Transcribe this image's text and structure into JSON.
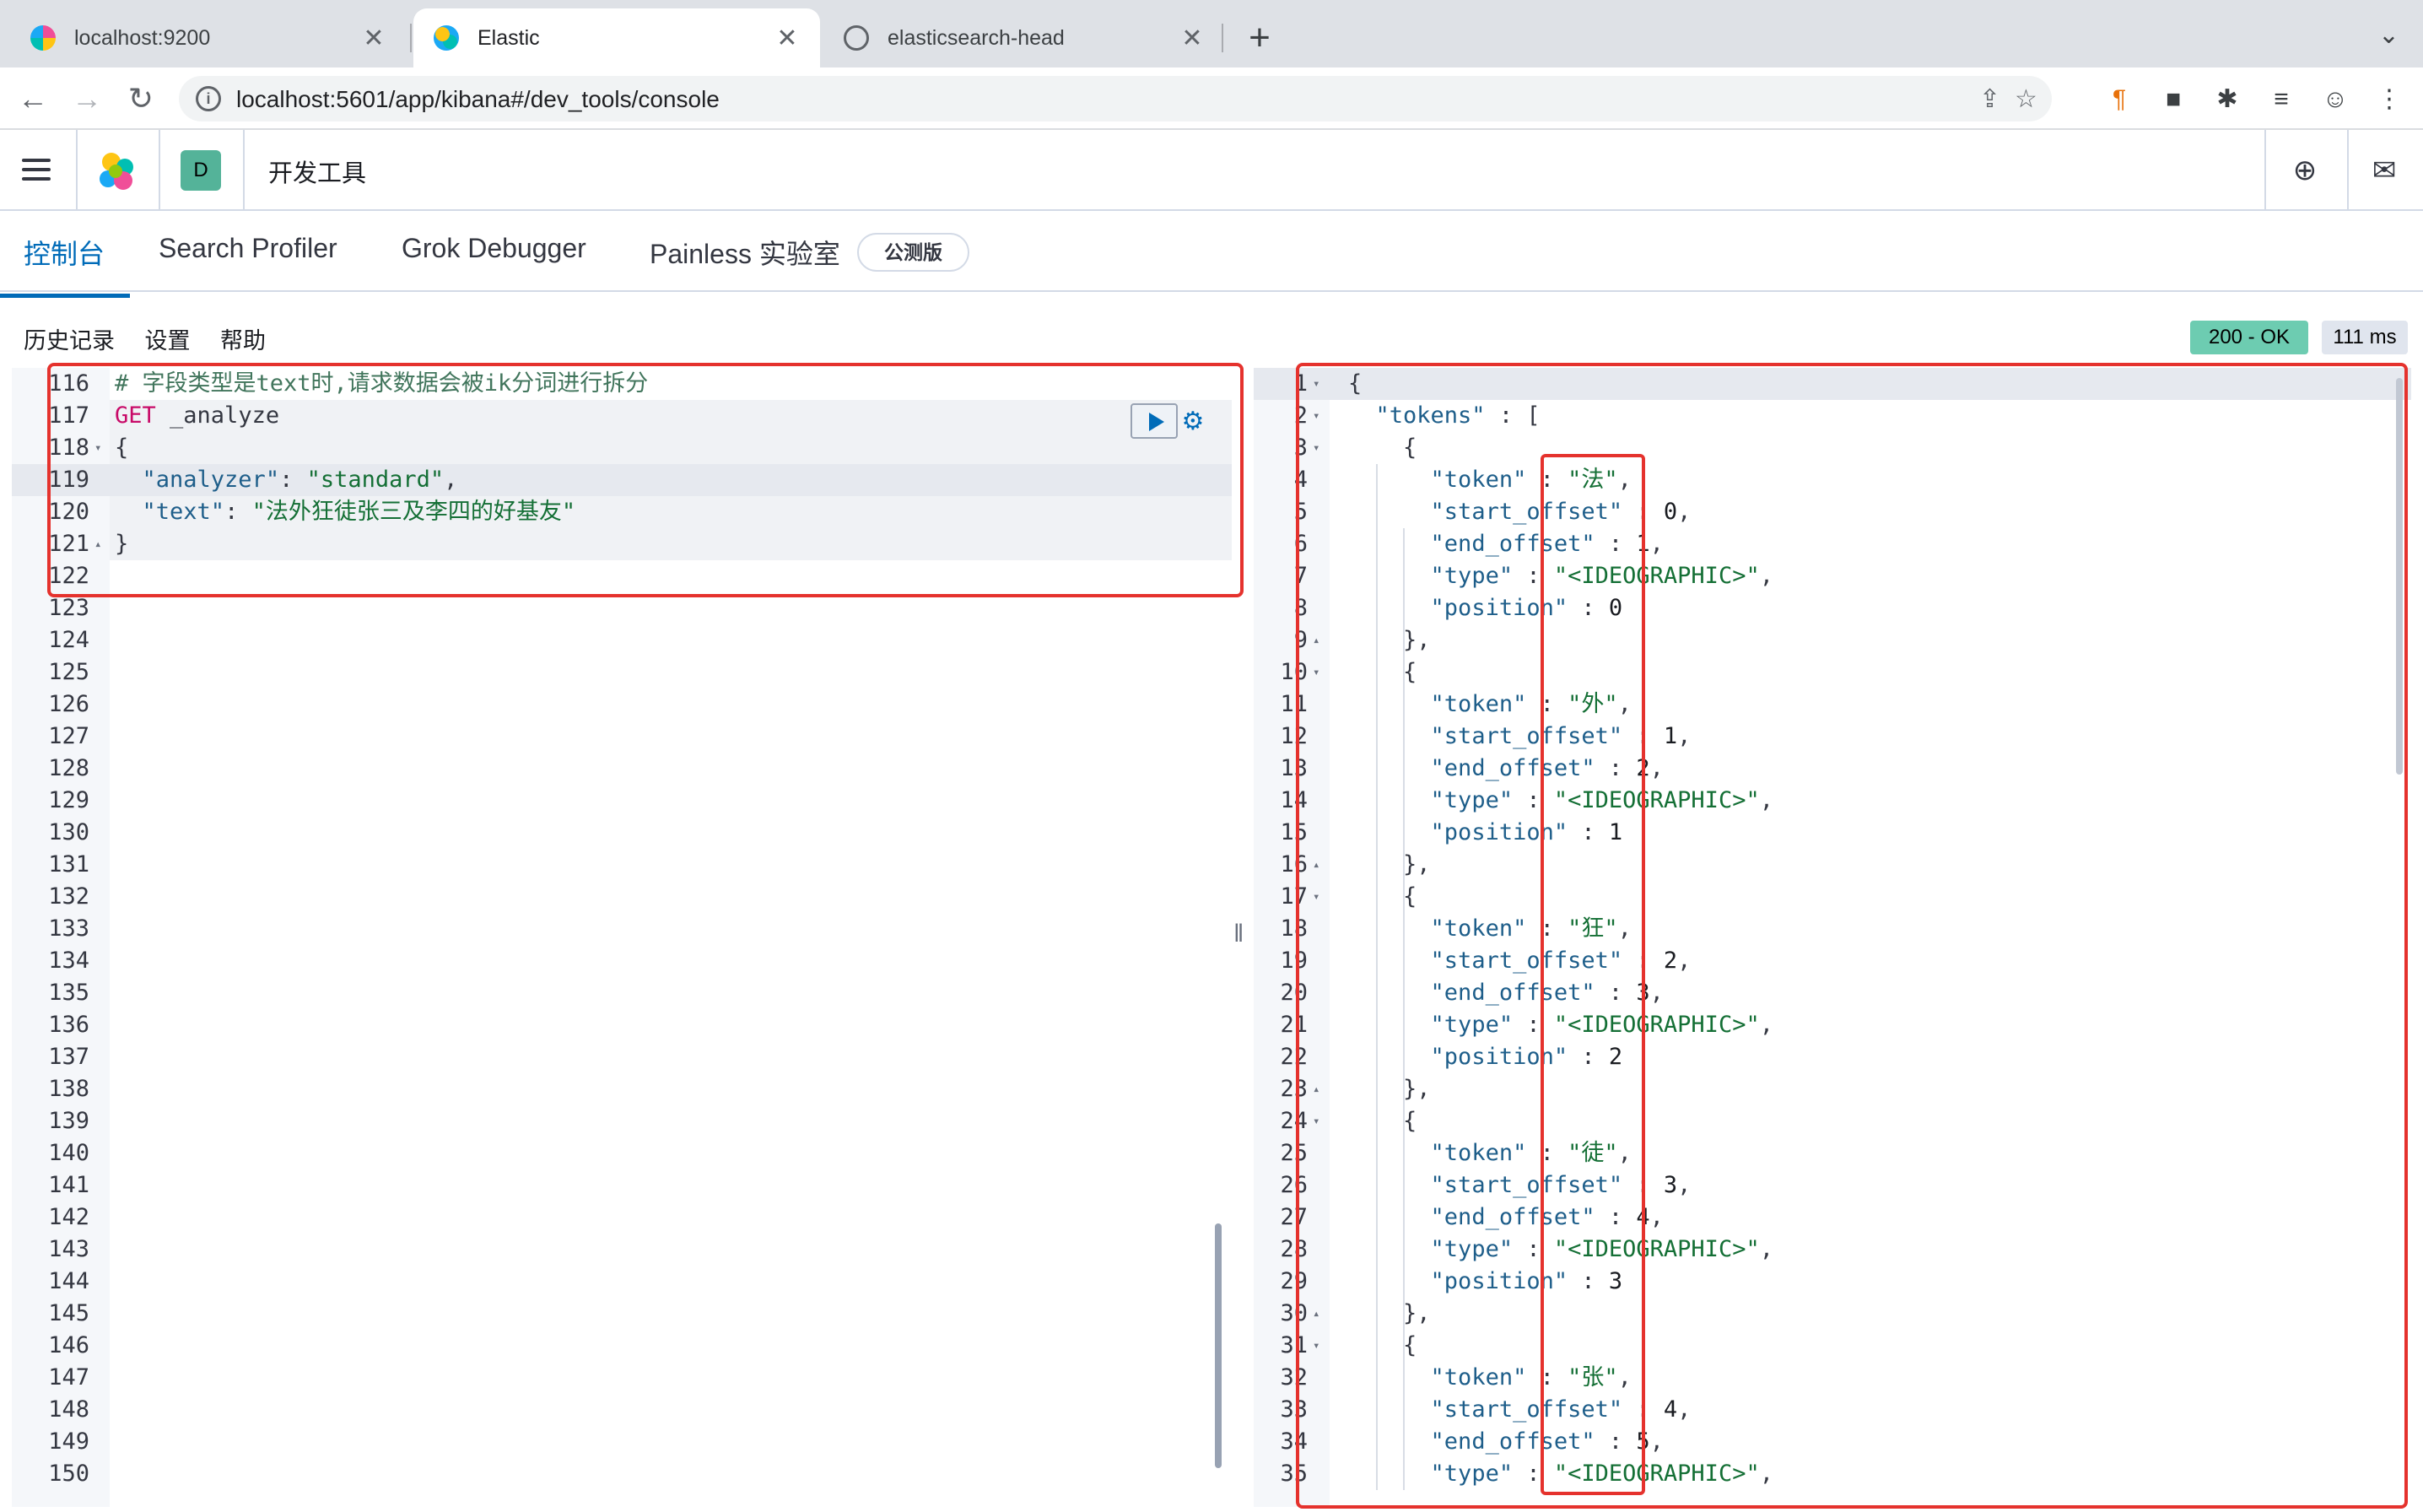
{
  "browser": {
    "tabs": [
      {
        "title": "localhost:9200",
        "close": "✕"
      },
      {
        "title": "Elastic",
        "close": "✕"
      },
      {
        "title": "elasticsearch-head",
        "close": "✕"
      }
    ],
    "new_tab": "+",
    "tab_menu": "⌄",
    "url": "localhost:5601/app/kibana#/dev_tools/console",
    "info_icon": "i"
  },
  "kibana": {
    "space_initial": "D",
    "app_title": "开发工具"
  },
  "dev_tabs": [
    {
      "label": "控制台"
    },
    {
      "label": "Search Profiler"
    },
    {
      "label": "Grok Debugger"
    },
    {
      "label": "Painless 实验室"
    }
  ],
  "beta_label": "公测版",
  "console_menu": {
    "history": "历史记录",
    "settings": "设置",
    "help": "帮助"
  },
  "response_status": {
    "status": "200 - OK",
    "time": "111 ms"
  },
  "request_lines": [
    {
      "n": "116",
      "fold": "",
      "text": "# 字段类型是text时,请求数据会被ik分词进行拆分"
    },
    {
      "n": "117",
      "fold": "",
      "text": "GET _analyze"
    },
    {
      "n": "118",
      "fold": "▾",
      "text": "{"
    },
    {
      "n": "119",
      "fold": "",
      "text": "  \"analyzer\": \"standard\","
    },
    {
      "n": "120",
      "fold": "",
      "text": "  \"text\": \"法外狂徒张三及李四的好基友\""
    },
    {
      "n": "121",
      "fold": "▴",
      "text": "}"
    },
    {
      "n": "122",
      "fold": "",
      "text": ""
    },
    {
      "n": "123",
      "fold": "",
      "text": ""
    },
    {
      "n": "124",
      "fold": "",
      "text": ""
    },
    {
      "n": "125",
      "fold": "",
      "text": ""
    },
    {
      "n": "126",
      "fold": "",
      "text": ""
    },
    {
      "n": "127",
      "fold": "",
      "text": ""
    },
    {
      "n": "128",
      "fold": "",
      "text": ""
    },
    {
      "n": "129",
      "fold": "",
      "text": ""
    },
    {
      "n": "130",
      "fold": "",
      "text": ""
    },
    {
      "n": "131",
      "fold": "",
      "text": ""
    },
    {
      "n": "132",
      "fold": "",
      "text": ""
    },
    {
      "n": "133",
      "fold": "",
      "text": ""
    },
    {
      "n": "134",
      "fold": "",
      "text": ""
    },
    {
      "n": "135",
      "fold": "",
      "text": ""
    },
    {
      "n": "136",
      "fold": "",
      "text": ""
    },
    {
      "n": "137",
      "fold": "",
      "text": ""
    },
    {
      "n": "138",
      "fold": "",
      "text": ""
    },
    {
      "n": "139",
      "fold": "",
      "text": ""
    },
    {
      "n": "140",
      "fold": "",
      "text": ""
    },
    {
      "n": "141",
      "fold": "",
      "text": ""
    },
    {
      "n": "142",
      "fold": "",
      "text": ""
    },
    {
      "n": "143",
      "fold": "",
      "text": ""
    },
    {
      "n": "144",
      "fold": "",
      "text": ""
    },
    {
      "n": "145",
      "fold": "",
      "text": ""
    },
    {
      "n": "146",
      "fold": "",
      "text": ""
    },
    {
      "n": "147",
      "fold": "",
      "text": ""
    },
    {
      "n": "148",
      "fold": "",
      "text": ""
    },
    {
      "n": "149",
      "fold": "",
      "text": ""
    },
    {
      "n": "150",
      "fold": "",
      "text": ""
    }
  ],
  "response_lines": [
    {
      "n": "1",
      "fold": "▾",
      "text": "{"
    },
    {
      "n": "2",
      "fold": "▾",
      "text": "  \"tokens\" : ["
    },
    {
      "n": "3",
      "fold": "▾",
      "text": "    {"
    },
    {
      "n": "4",
      "fold": "",
      "text": "      \"token\" : \"法\","
    },
    {
      "n": "5",
      "fold": "",
      "text": "      \"start_offset\" : 0,"
    },
    {
      "n": "6",
      "fold": "",
      "text": "      \"end_offset\" : 1,"
    },
    {
      "n": "7",
      "fold": "",
      "text": "      \"type\" : \"<IDEOGRAPHIC>\","
    },
    {
      "n": "8",
      "fold": "",
      "text": "      \"position\" : 0"
    },
    {
      "n": "9",
      "fold": "▴",
      "text": "    },"
    },
    {
      "n": "10",
      "fold": "▾",
      "text": "    {"
    },
    {
      "n": "11",
      "fold": "",
      "text": "      \"token\" : \"外\","
    },
    {
      "n": "12",
      "fold": "",
      "text": "      \"start_offset\" : 1,"
    },
    {
      "n": "13",
      "fold": "",
      "text": "      \"end_offset\" : 2,"
    },
    {
      "n": "14",
      "fold": "",
      "text": "      \"type\" : \"<IDEOGRAPHIC>\","
    },
    {
      "n": "15",
      "fold": "",
      "text": "      \"position\" : 1"
    },
    {
      "n": "16",
      "fold": "▴",
      "text": "    },"
    },
    {
      "n": "17",
      "fold": "▾",
      "text": "    {"
    },
    {
      "n": "18",
      "fold": "",
      "text": "      \"token\" : \"狂\","
    },
    {
      "n": "19",
      "fold": "",
      "text": "      \"start_offset\" : 2,"
    },
    {
      "n": "20",
      "fold": "",
      "text": "      \"end_offset\" : 3,"
    },
    {
      "n": "21",
      "fold": "",
      "text": "      \"type\" : \"<IDEOGRAPHIC>\","
    },
    {
      "n": "22",
      "fold": "",
      "text": "      \"position\" : 2"
    },
    {
      "n": "23",
      "fold": "▴",
      "text": "    },"
    },
    {
      "n": "24",
      "fold": "▾",
      "text": "    {"
    },
    {
      "n": "25",
      "fold": "",
      "text": "      \"token\" : \"徒\","
    },
    {
      "n": "26",
      "fold": "",
      "text": "      \"start_offset\" : 3,"
    },
    {
      "n": "27",
      "fold": "",
      "text": "      \"end_offset\" : 4,"
    },
    {
      "n": "28",
      "fold": "",
      "text": "      \"type\" : \"<IDEOGRAPHIC>\","
    },
    {
      "n": "29",
      "fold": "",
      "text": "      \"position\" : 3"
    },
    {
      "n": "30",
      "fold": "▴",
      "text": "    },"
    },
    {
      "n": "31",
      "fold": "▾",
      "text": "    {"
    },
    {
      "n": "32",
      "fold": "",
      "text": "      \"token\" : \"张\","
    },
    {
      "n": "33",
      "fold": "",
      "text": "      \"start_offset\" : 4,"
    },
    {
      "n": "34",
      "fold": "",
      "text": "      \"end_offset\" : 5,"
    },
    {
      "n": "35",
      "fold": "",
      "text": "      \"type\" : \"<IDEOGRAPHIC>\","
    }
  ],
  "icons": {
    "back": "arrow-left-icon",
    "forward": "arrow-right-icon",
    "reload": "reload-icon",
    "share": "share-icon",
    "star": "star-icon",
    "extensions": "puzzle-icon",
    "help": "help-icon",
    "mail": "mail-icon",
    "run": "play-icon",
    "wrench": "wrench-icon"
  },
  "colors": {
    "accent": "#006bb8",
    "status_ok": "#6dccb1",
    "highlight_box": "#e5322d",
    "space_badge": "#54b399"
  }
}
